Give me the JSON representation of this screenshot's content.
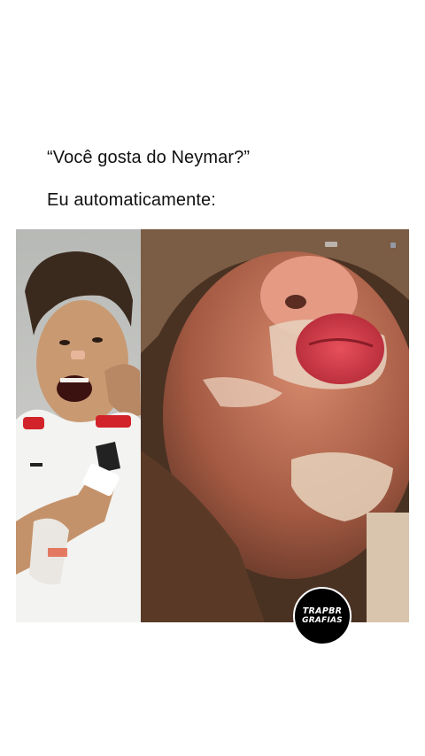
{
  "caption": {
    "line1": "“Você gosta do Neymar?”",
    "line2": "Eu automaticamente:"
  },
  "watermark": {
    "line1": "TRAPBR",
    "line2": "GRAFIAS"
  },
  "colors": {
    "background": "#ffffff",
    "text": "#111111",
    "watermark_bg": "#000000",
    "watermark_text": "#ffffff"
  }
}
